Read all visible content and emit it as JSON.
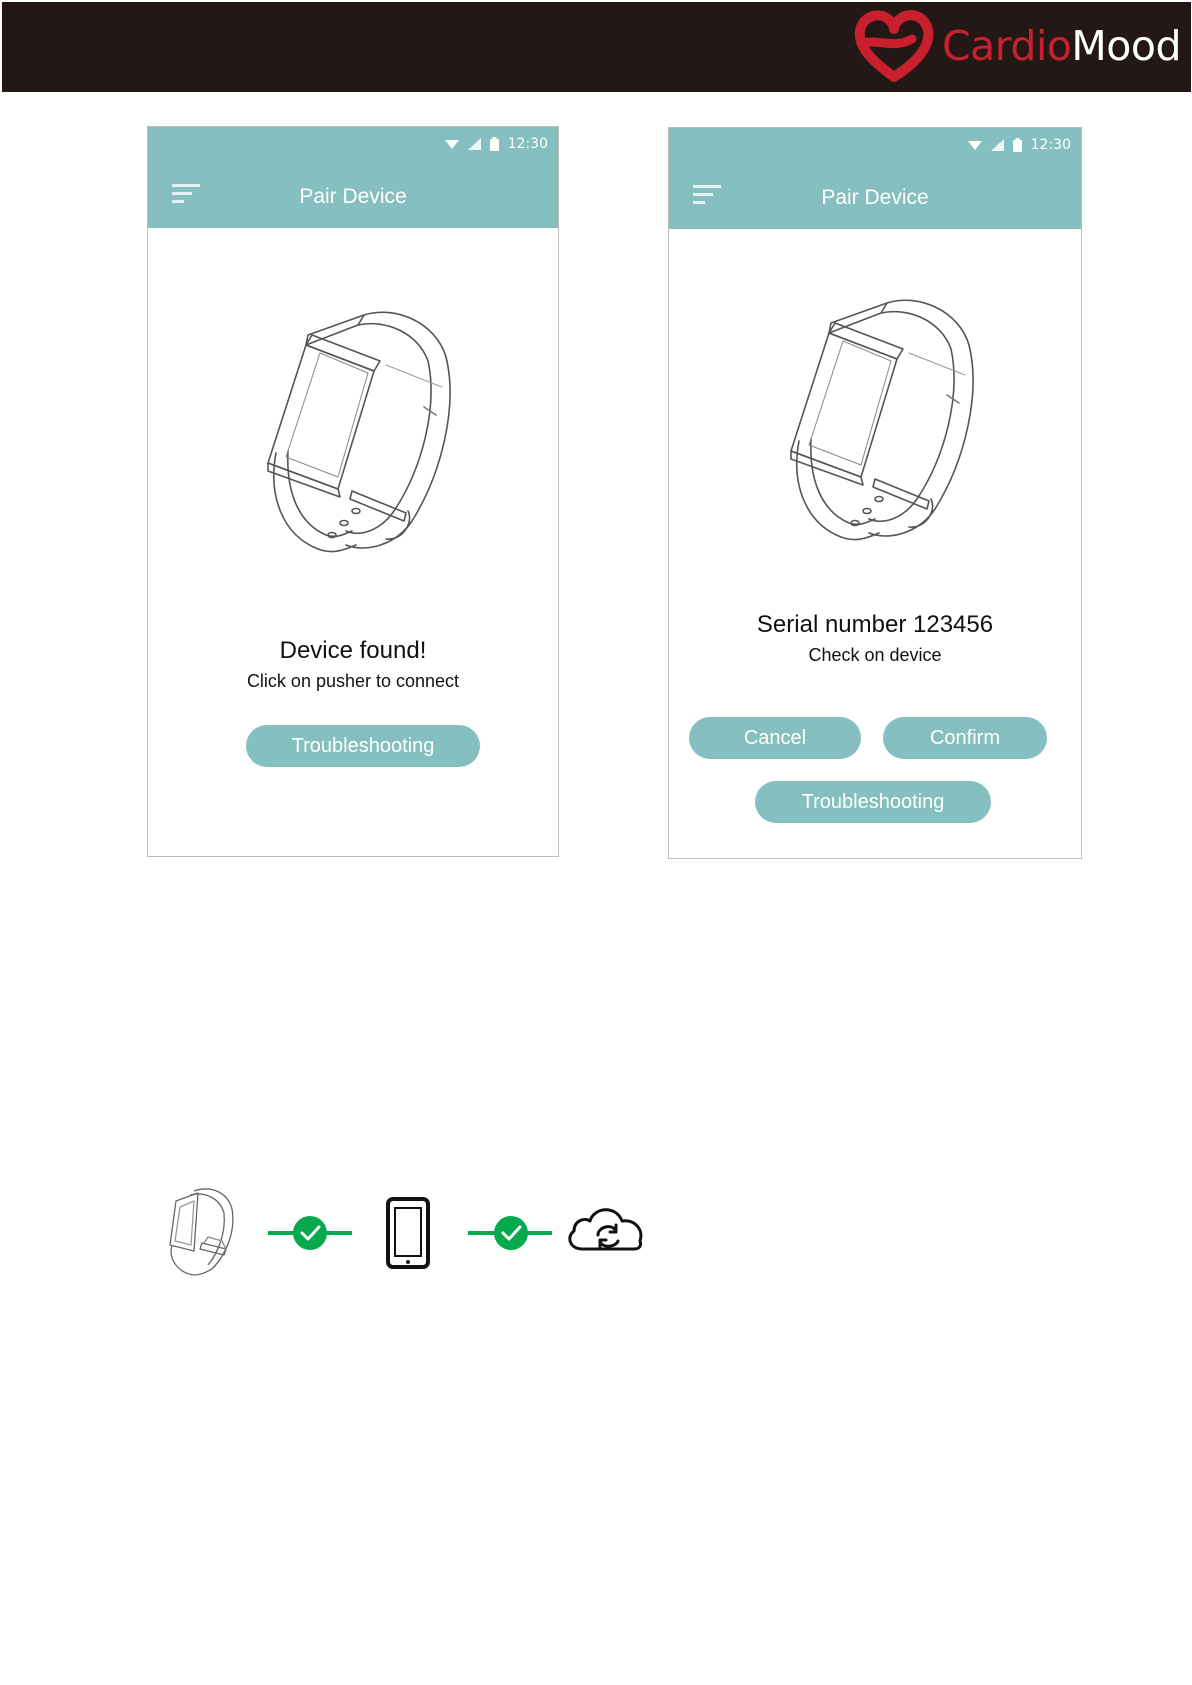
{
  "brand": {
    "name_part1": "Cardio",
    "name_part2": "Mood",
    "icon": "heart-logo-icon"
  },
  "screens": [
    {
      "status": {
        "time": "12:30"
      },
      "title": "Pair Device",
      "message": "Device found!",
      "sub_message": "Click on pusher to connect",
      "buttons": {
        "troubleshooting": "Troubleshooting"
      }
    },
    {
      "status": {
        "time": "12:30"
      },
      "title": "Pair Device",
      "message": "Serial number 123456",
      "sub_message": "Check on device",
      "buttons": {
        "cancel": "Cancel",
        "confirm": "Confirm",
        "troubleshooting": "Troubleshooting"
      }
    }
  ],
  "connection_flow": {
    "steps": [
      "bracelet-icon",
      "check-icon",
      "smartphone-icon",
      "check-icon",
      "cloud-sync-icon"
    ]
  },
  "colors": {
    "header_bg": "#231815",
    "brand_red": "#c8202e",
    "accent_teal": "#85bfbf",
    "success_green": "#06a94d"
  }
}
